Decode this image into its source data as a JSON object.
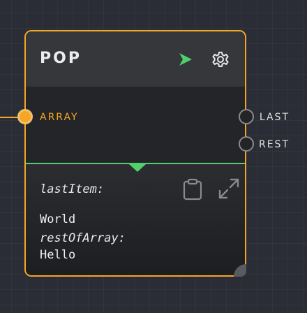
{
  "node": {
    "title": "POP",
    "accent_color": "#f5a623",
    "status_color": "#4fd06a",
    "header_icons": [
      "play-icon",
      "gear-icon"
    ],
    "inputs": [
      {
        "label": "ARRAY"
      }
    ],
    "outputs": [
      {
        "label": "LAST"
      },
      {
        "label": "REST"
      }
    ],
    "result_actions": [
      "clipboard-icon",
      "expand-icon"
    ],
    "result": [
      {
        "key": "lastItem:",
        "value": "World"
      },
      {
        "key": "restOfArray:",
        "value": "Hello"
      }
    ]
  }
}
